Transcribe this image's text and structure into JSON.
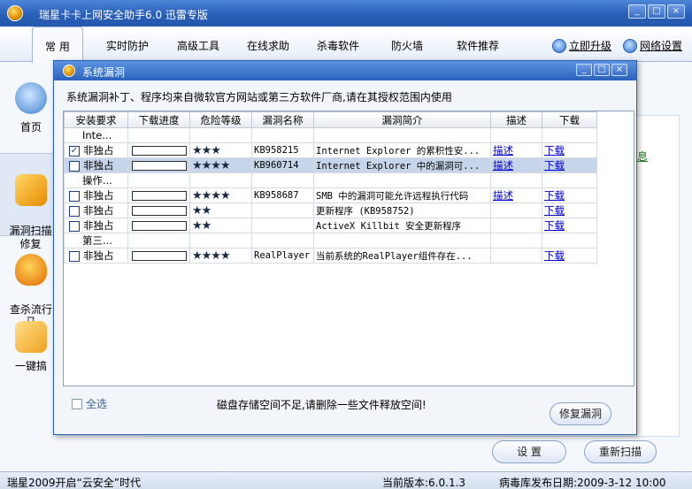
{
  "window": {
    "title": "瑞星卡卡上网安全助手6.0 迅雷专版",
    "buttons": [
      "_",
      "□",
      "×"
    ]
  },
  "menu": {
    "tabs": [
      "常 用",
      "实时防护",
      "高级工具",
      "在线求助",
      "杀毒软件",
      "防火墙",
      "软件推荐"
    ],
    "upgrade": "立即升级",
    "network_settings": "网络设置"
  },
  "sidebar": {
    "items": [
      "首页",
      "漏洞扫描\n修复",
      "查杀流行\n马",
      "一键搞"
    ]
  },
  "background": {
    "side_link": "息",
    "settings_button": "设 置",
    "rescan_button": "重新扫描"
  },
  "dialog": {
    "title": "系统漏洞",
    "description": "系统漏洞补丁、程序均来自微软官方网站或第三方软件厂商,请在其授权范围内使用",
    "columns": [
      "安装要求",
      "下载进度",
      "危险等级",
      "漏洞名称",
      "漏洞简介",
      "描述",
      "下载"
    ],
    "rows": [
      {
        "group": true,
        "req": "Inte..."
      },
      {
        "checked": true,
        "req": "非独占",
        "progress": true,
        "stars": "★★★",
        "name": "KB958215",
        "desc": "Internet Explorer 的累积性安...",
        "describe": "描述",
        "download": "下载"
      },
      {
        "checked": false,
        "selected": true,
        "req": "非独占",
        "progress": true,
        "stars": "★★★★",
        "name": "KB960714",
        "desc": "Internet Explorer 中的漏洞可...",
        "describe": "描述",
        "download": "下载"
      },
      {
        "group": true,
        "req": "操作..."
      },
      {
        "checked": false,
        "req": "非独占",
        "progress": true,
        "stars": "★★★★",
        "name": "KB958687",
        "desc": "SMB 中的漏洞可能允许远程执行代码",
        "describe": "描述",
        "download": "下载"
      },
      {
        "checked": false,
        "req": "非独占",
        "progress": true,
        "stars": "★★",
        "name": "",
        "desc": "更新程序 (KB958752)",
        "describe": "",
        "download": "下载"
      },
      {
        "checked": false,
        "req": "非独占",
        "progress": true,
        "stars": "★★",
        "name": "",
        "desc": "ActiveX Killbit 安全更新程序",
        "describe": "",
        "download": "下载"
      },
      {
        "group": true,
        "req": "第三..."
      },
      {
        "checked": false,
        "req": "非独占",
        "progress": true,
        "stars": "★★★★",
        "name": "RealPlayer",
        "desc": "当前系统的RealPlayer组件存在...",
        "describe": "",
        "download": "下载"
      }
    ],
    "select_all": "全选",
    "disk_message": "磁盘存储空间不足,请删除一些文件释放空间!",
    "repair_button": "修复漏洞"
  },
  "statusbar": {
    "slogan": "瑞星2009开启“云安全”时代",
    "version": "当前版本:6.0.1.3",
    "virus_db_date": "病毒库发布日期:2009-3-12 10:00"
  },
  "colors": {
    "titlebar": "#2a5fb8",
    "selected_row": "#c7d5ea",
    "link": "#0000cc"
  }
}
